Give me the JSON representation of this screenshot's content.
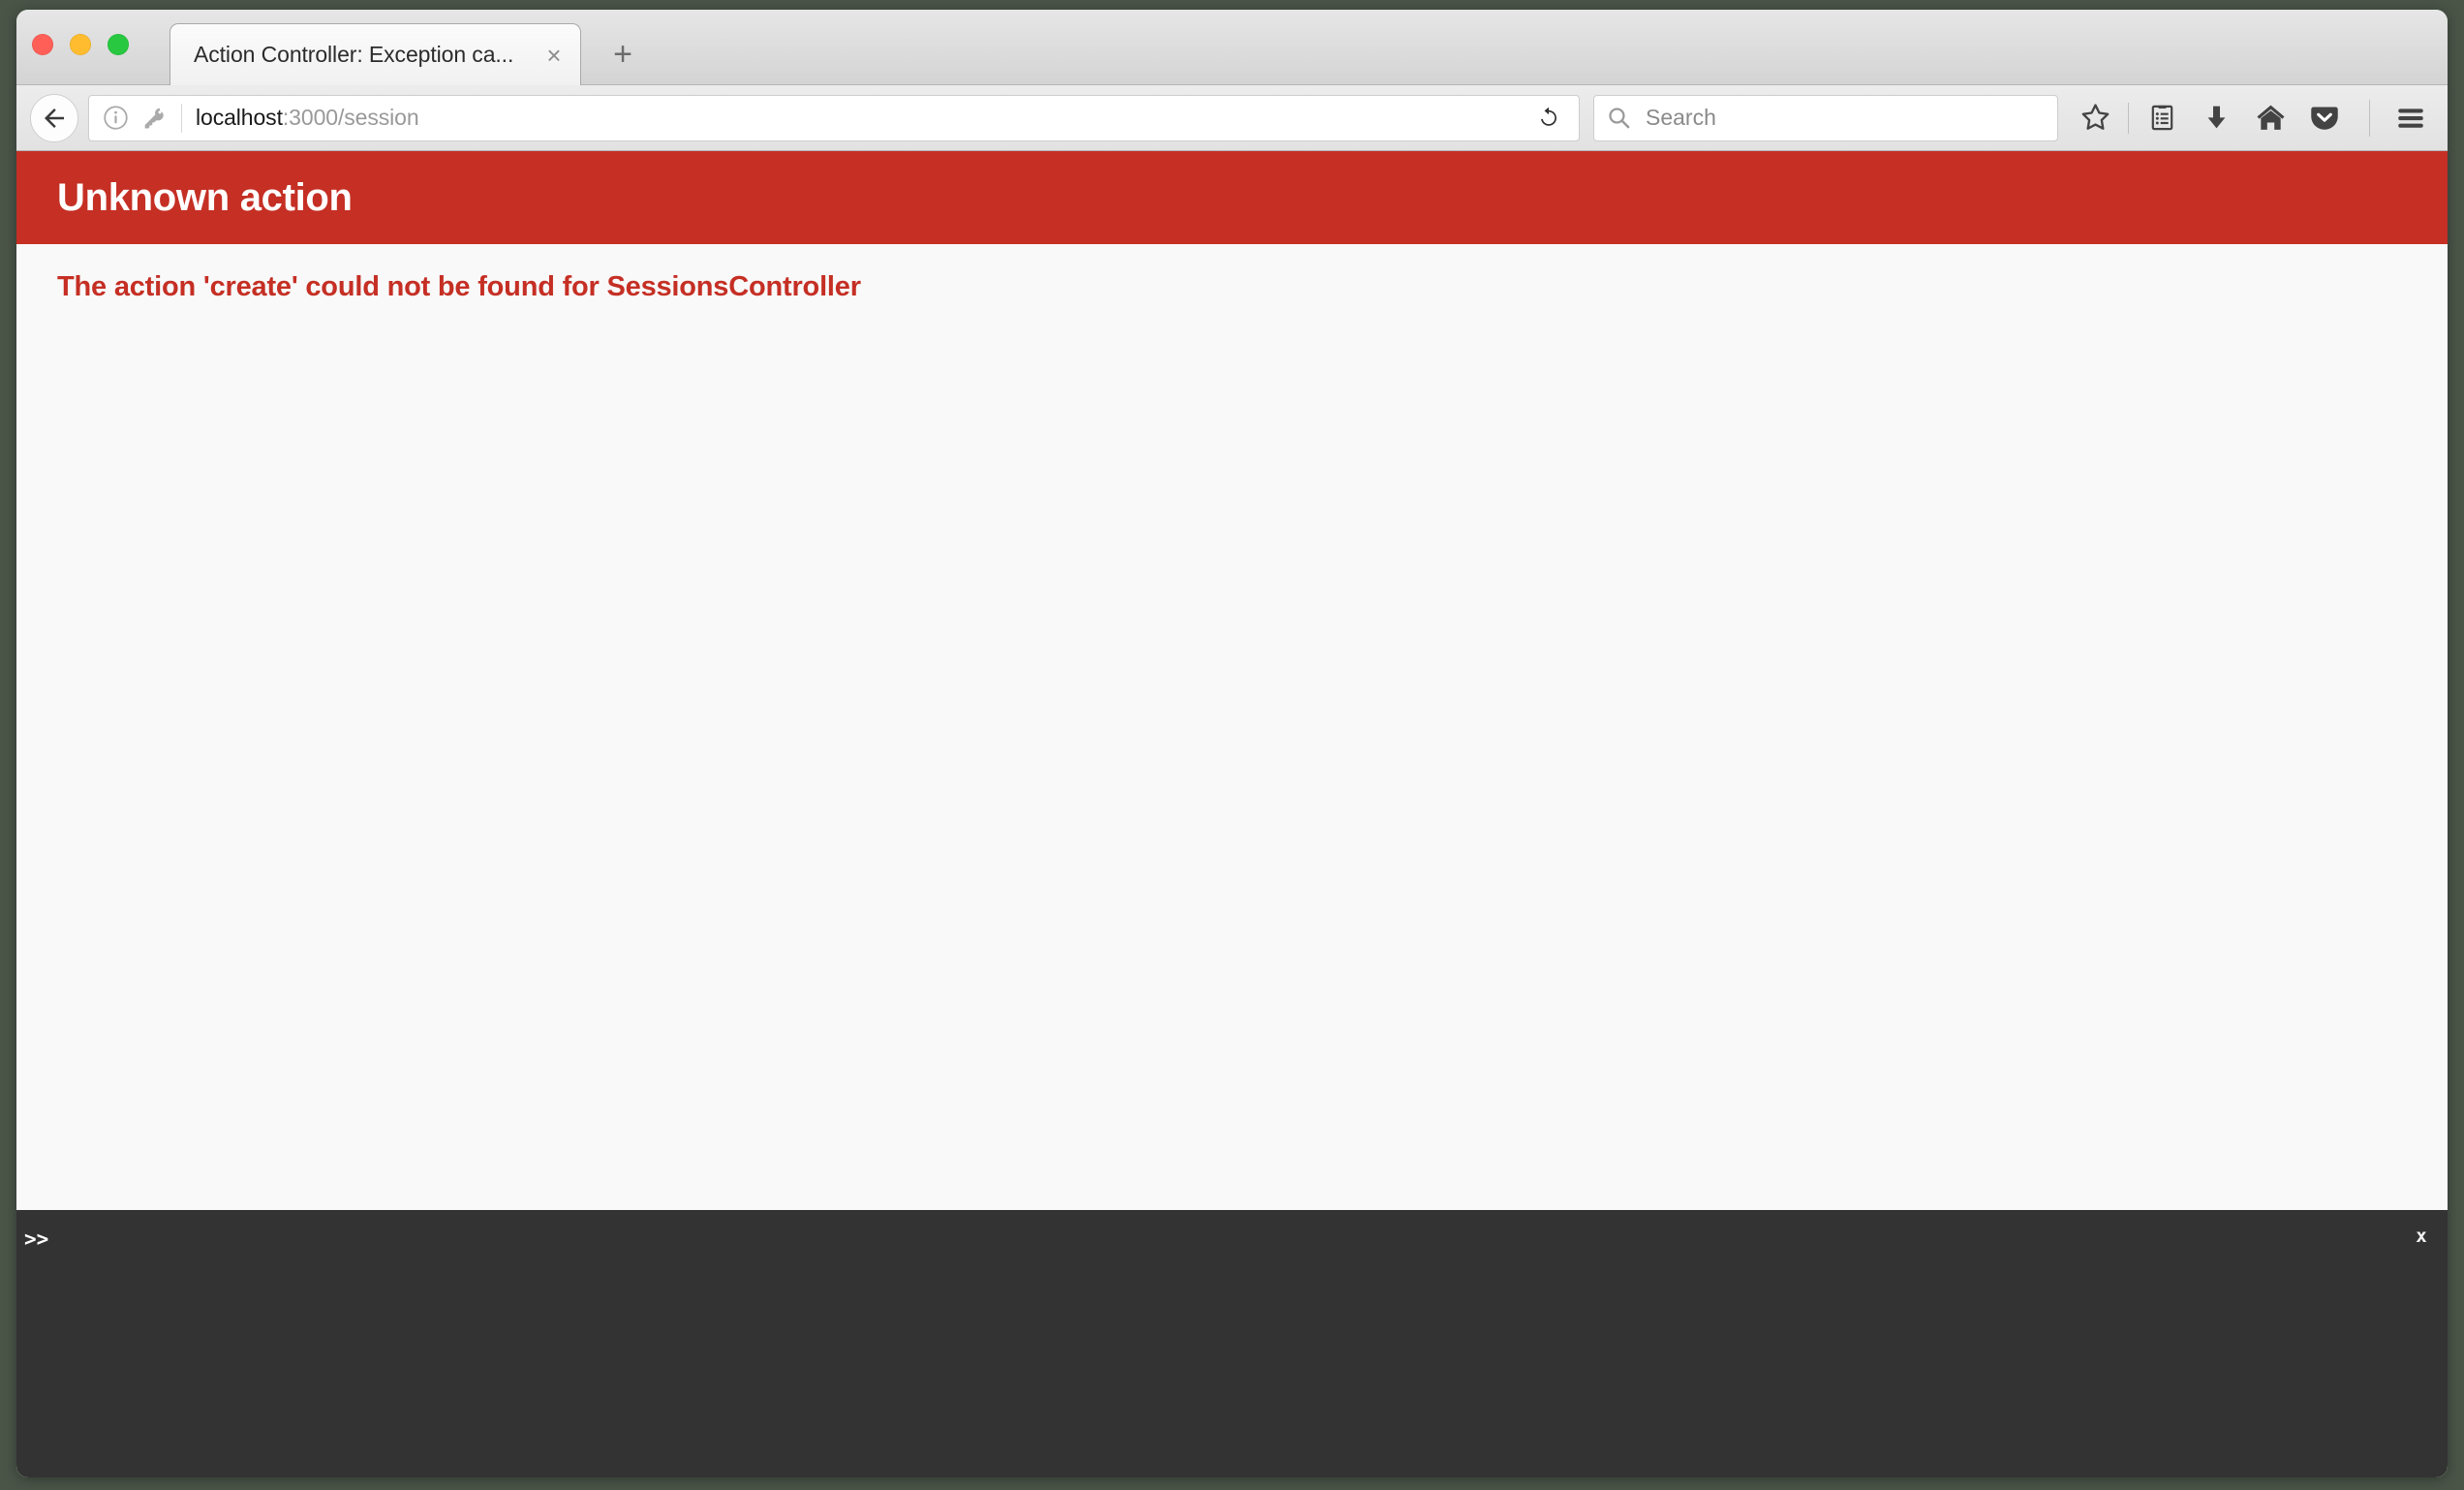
{
  "window": {
    "traffic_lights": [
      {
        "name": "close",
        "color": "#ff5f57"
      },
      {
        "name": "minimize",
        "color": "#febc2e"
      },
      {
        "name": "zoom",
        "color": "#28c840"
      }
    ]
  },
  "tabs": {
    "active": {
      "title": "Action Controller: Exception ca...",
      "close_label": "×"
    },
    "new_tab_label": "+"
  },
  "toolbar": {
    "back_icon": "back-arrow-icon",
    "identity_icons": [
      "info-circle-icon",
      "key-icon"
    ],
    "url": {
      "host": "localhost",
      "path": ":3000/session",
      "full": "localhost:3000/session"
    },
    "reload_icon": "reload-icon",
    "search": {
      "placeholder": "Search",
      "icon": "search-icon"
    },
    "buttons": [
      {
        "name": "bookmark-star-icon",
        "label": ""
      },
      {
        "name": "reading-list-icon",
        "label": ""
      },
      {
        "name": "downloads-icon",
        "label": ""
      },
      {
        "name": "home-icon",
        "label": ""
      },
      {
        "name": "pocket-icon",
        "label": ""
      },
      {
        "name": "hamburger-menu-icon",
        "label": ""
      }
    ]
  },
  "page": {
    "banner_title": "Unknown action",
    "banner_color": "#c52f24",
    "error_message": "The action 'create' could not be found for SessionsController",
    "error_text_color": "#c52f24",
    "background_color": "#f9f9f9"
  },
  "console": {
    "prompt": ">>",
    "close_label": "x",
    "background_color": "#333333",
    "input_value": ""
  }
}
